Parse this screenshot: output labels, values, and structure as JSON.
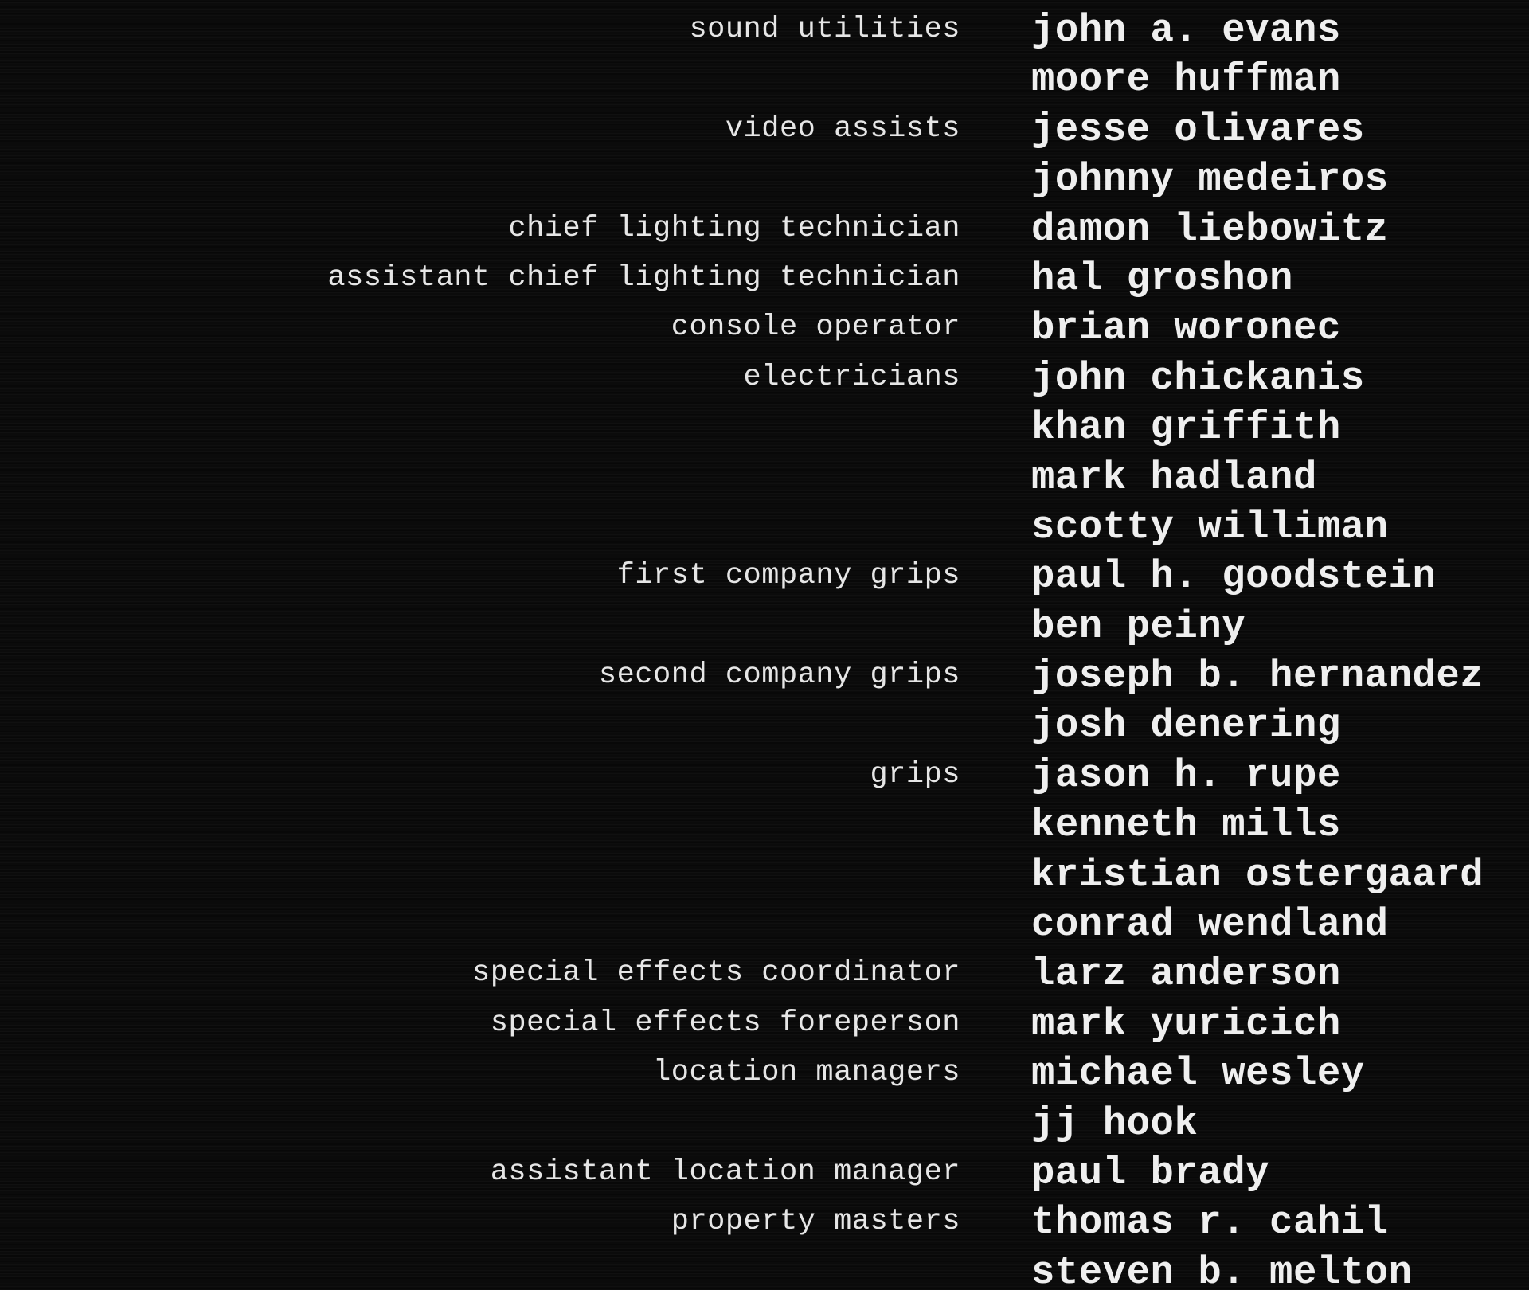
{
  "credits": [
    {
      "role": "sound utilities",
      "name": "john a. evans"
    },
    {
      "role": "",
      "name": "moore huffman"
    },
    {
      "role": "video assists",
      "name": "jesse olivares"
    },
    {
      "role": "",
      "name": "johnny medeiros"
    },
    {
      "role": "chief lighting technician",
      "name": "damon liebowitz"
    },
    {
      "role": "assistant chief lighting technician",
      "name": "hal groshon"
    },
    {
      "role": "console operator",
      "name": "brian woronec"
    },
    {
      "role": "electricians",
      "name": "john chickanis"
    },
    {
      "role": "",
      "name": "khan griffith"
    },
    {
      "role": "",
      "name": "mark hadland"
    },
    {
      "role": "",
      "name": "scotty williman"
    },
    {
      "role": "first company grips",
      "name": "paul h. goodstein"
    },
    {
      "role": "",
      "name": "ben peiny"
    },
    {
      "role": "second company grips",
      "name": "joseph b. hernandez"
    },
    {
      "role": "",
      "name": "josh denering"
    },
    {
      "role": "grips",
      "name": "jason h. rupe"
    },
    {
      "role": "",
      "name": "kenneth mills"
    },
    {
      "role": "",
      "name": "kristian ostergaard"
    },
    {
      "role": "",
      "name": "conrad wendland"
    },
    {
      "role": "special effects coordinator",
      "name": "larz anderson"
    },
    {
      "role": "special effects foreperson",
      "name": "mark yuricich"
    },
    {
      "role": "location managers",
      "name": "michael wesley"
    },
    {
      "role": "",
      "name": "jj hook"
    },
    {
      "role": "assistant location manager",
      "name": "paul brady"
    },
    {
      "role": "property masters",
      "name": "thomas r. cahil"
    },
    {
      "role": "",
      "name": "steven b. melton"
    }
  ]
}
